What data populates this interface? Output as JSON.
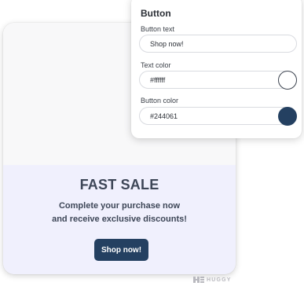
{
  "preview": {
    "headline": "FAST SALE",
    "subtext_line1": "Complete your purchase now",
    "subtext_line2": "and receive exclusive discounts!",
    "button_label": "Shop now!"
  },
  "branding": {
    "text": "HUGGY",
    "logo_icon": "huggy-logo-icon"
  },
  "settings": {
    "title": "Button",
    "button_text": {
      "label": "Button text",
      "value": "Shop now!"
    },
    "text_color": {
      "label": "Text color",
      "value": "#ffffff"
    },
    "button_color": {
      "label": "Button color",
      "value": "#244061"
    }
  },
  "colors": {
    "button_bg": "#244061",
    "button_text": "#ffffff",
    "preview_body_bg": "#f0f0fd",
    "headline_text": "#3d4657"
  }
}
